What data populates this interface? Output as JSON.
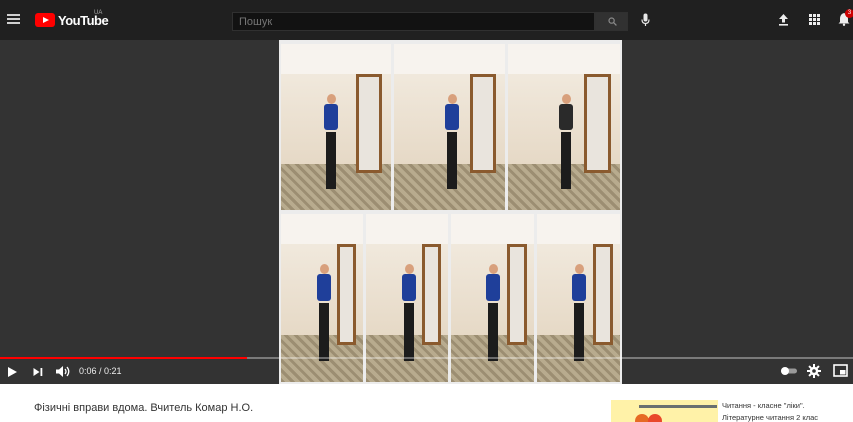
{
  "header": {
    "logo_text": "YouTube",
    "country_code": "UA",
    "search_placeholder": "Пошук",
    "notifications_count": "3"
  },
  "player": {
    "progress": 0.29,
    "time": "0:06 / 0:21",
    "progress_color": "#ff0000"
  },
  "video": {
    "title": "Фізичні вправи вдома. Вчитель Комар Н.О."
  },
  "related": {
    "title": "Читання - класне \"ліки\".",
    "subtitle": "Літературне читання 2 клас"
  },
  "icons": {
    "menu": "hamburger-menu-icon",
    "search": "search-icon",
    "mic": "microphone-icon",
    "upload": "upload-icon",
    "apps": "apps-grid-icon",
    "notifications": "bell-icon",
    "play": "play-icon",
    "next": "skip-next-icon",
    "volume": "volume-icon",
    "autoplay": "autoplay-toggle-icon",
    "settings": "gear-icon",
    "miniplayer": "miniplayer-icon"
  }
}
